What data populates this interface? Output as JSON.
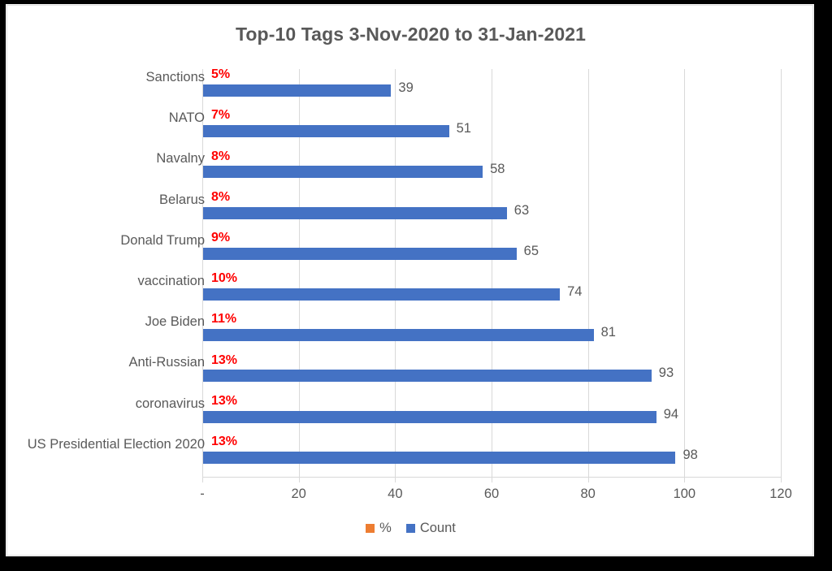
{
  "chart_data": {
    "type": "bar",
    "orientation": "horizontal",
    "title": "Top-10 Tags 3-Nov-2020 to 31-Jan-2021",
    "xlabel": "",
    "ylabel": "",
    "xlim": [
      0,
      120
    ],
    "grid": true,
    "legend_position": "bottom",
    "categories": [
      "Sanctions",
      "NATO",
      "Navalny",
      "Belarus",
      "Donald Trump",
      "vaccination",
      "Joe Biden",
      "Anti-Russian",
      "coronavirus",
      "US Presidential Election 2020"
    ],
    "series": [
      {
        "name": "%",
        "color": "#ED7D31",
        "values": [
          5,
          7,
          8,
          8,
          9,
          10,
          11,
          13,
          13,
          13
        ],
        "labels": [
          "5%",
          "7%",
          "8%",
          "8%",
          "9%",
          "10%",
          "11%",
          "13%",
          "13%",
          "13%"
        ],
        "label_color": "#FF0000"
      },
      {
        "name": "Count",
        "color": "#4472C4",
        "values": [
          39,
          51,
          58,
          63,
          65,
          74,
          81,
          93,
          94,
          98
        ],
        "labels": [
          "39",
          "51",
          "58",
          "63",
          "65",
          "74",
          "81",
          "93",
          "94",
          "98"
        ],
        "label_color": "#595959"
      }
    ],
    "xticks": [
      {
        "value": 0,
        "label": "-"
      },
      {
        "value": 20,
        "label": "20"
      },
      {
        "value": 40,
        "label": "40"
      },
      {
        "value": 60,
        "label": "60"
      },
      {
        "value": 80,
        "label": "80"
      },
      {
        "value": 100,
        "label": "100"
      },
      {
        "value": 120,
        "label": "120"
      }
    ]
  },
  "legend": {
    "items": [
      {
        "label": "%",
        "color": "#ED7D31"
      },
      {
        "label": "Count",
        "color": "#4472C4"
      }
    ]
  }
}
